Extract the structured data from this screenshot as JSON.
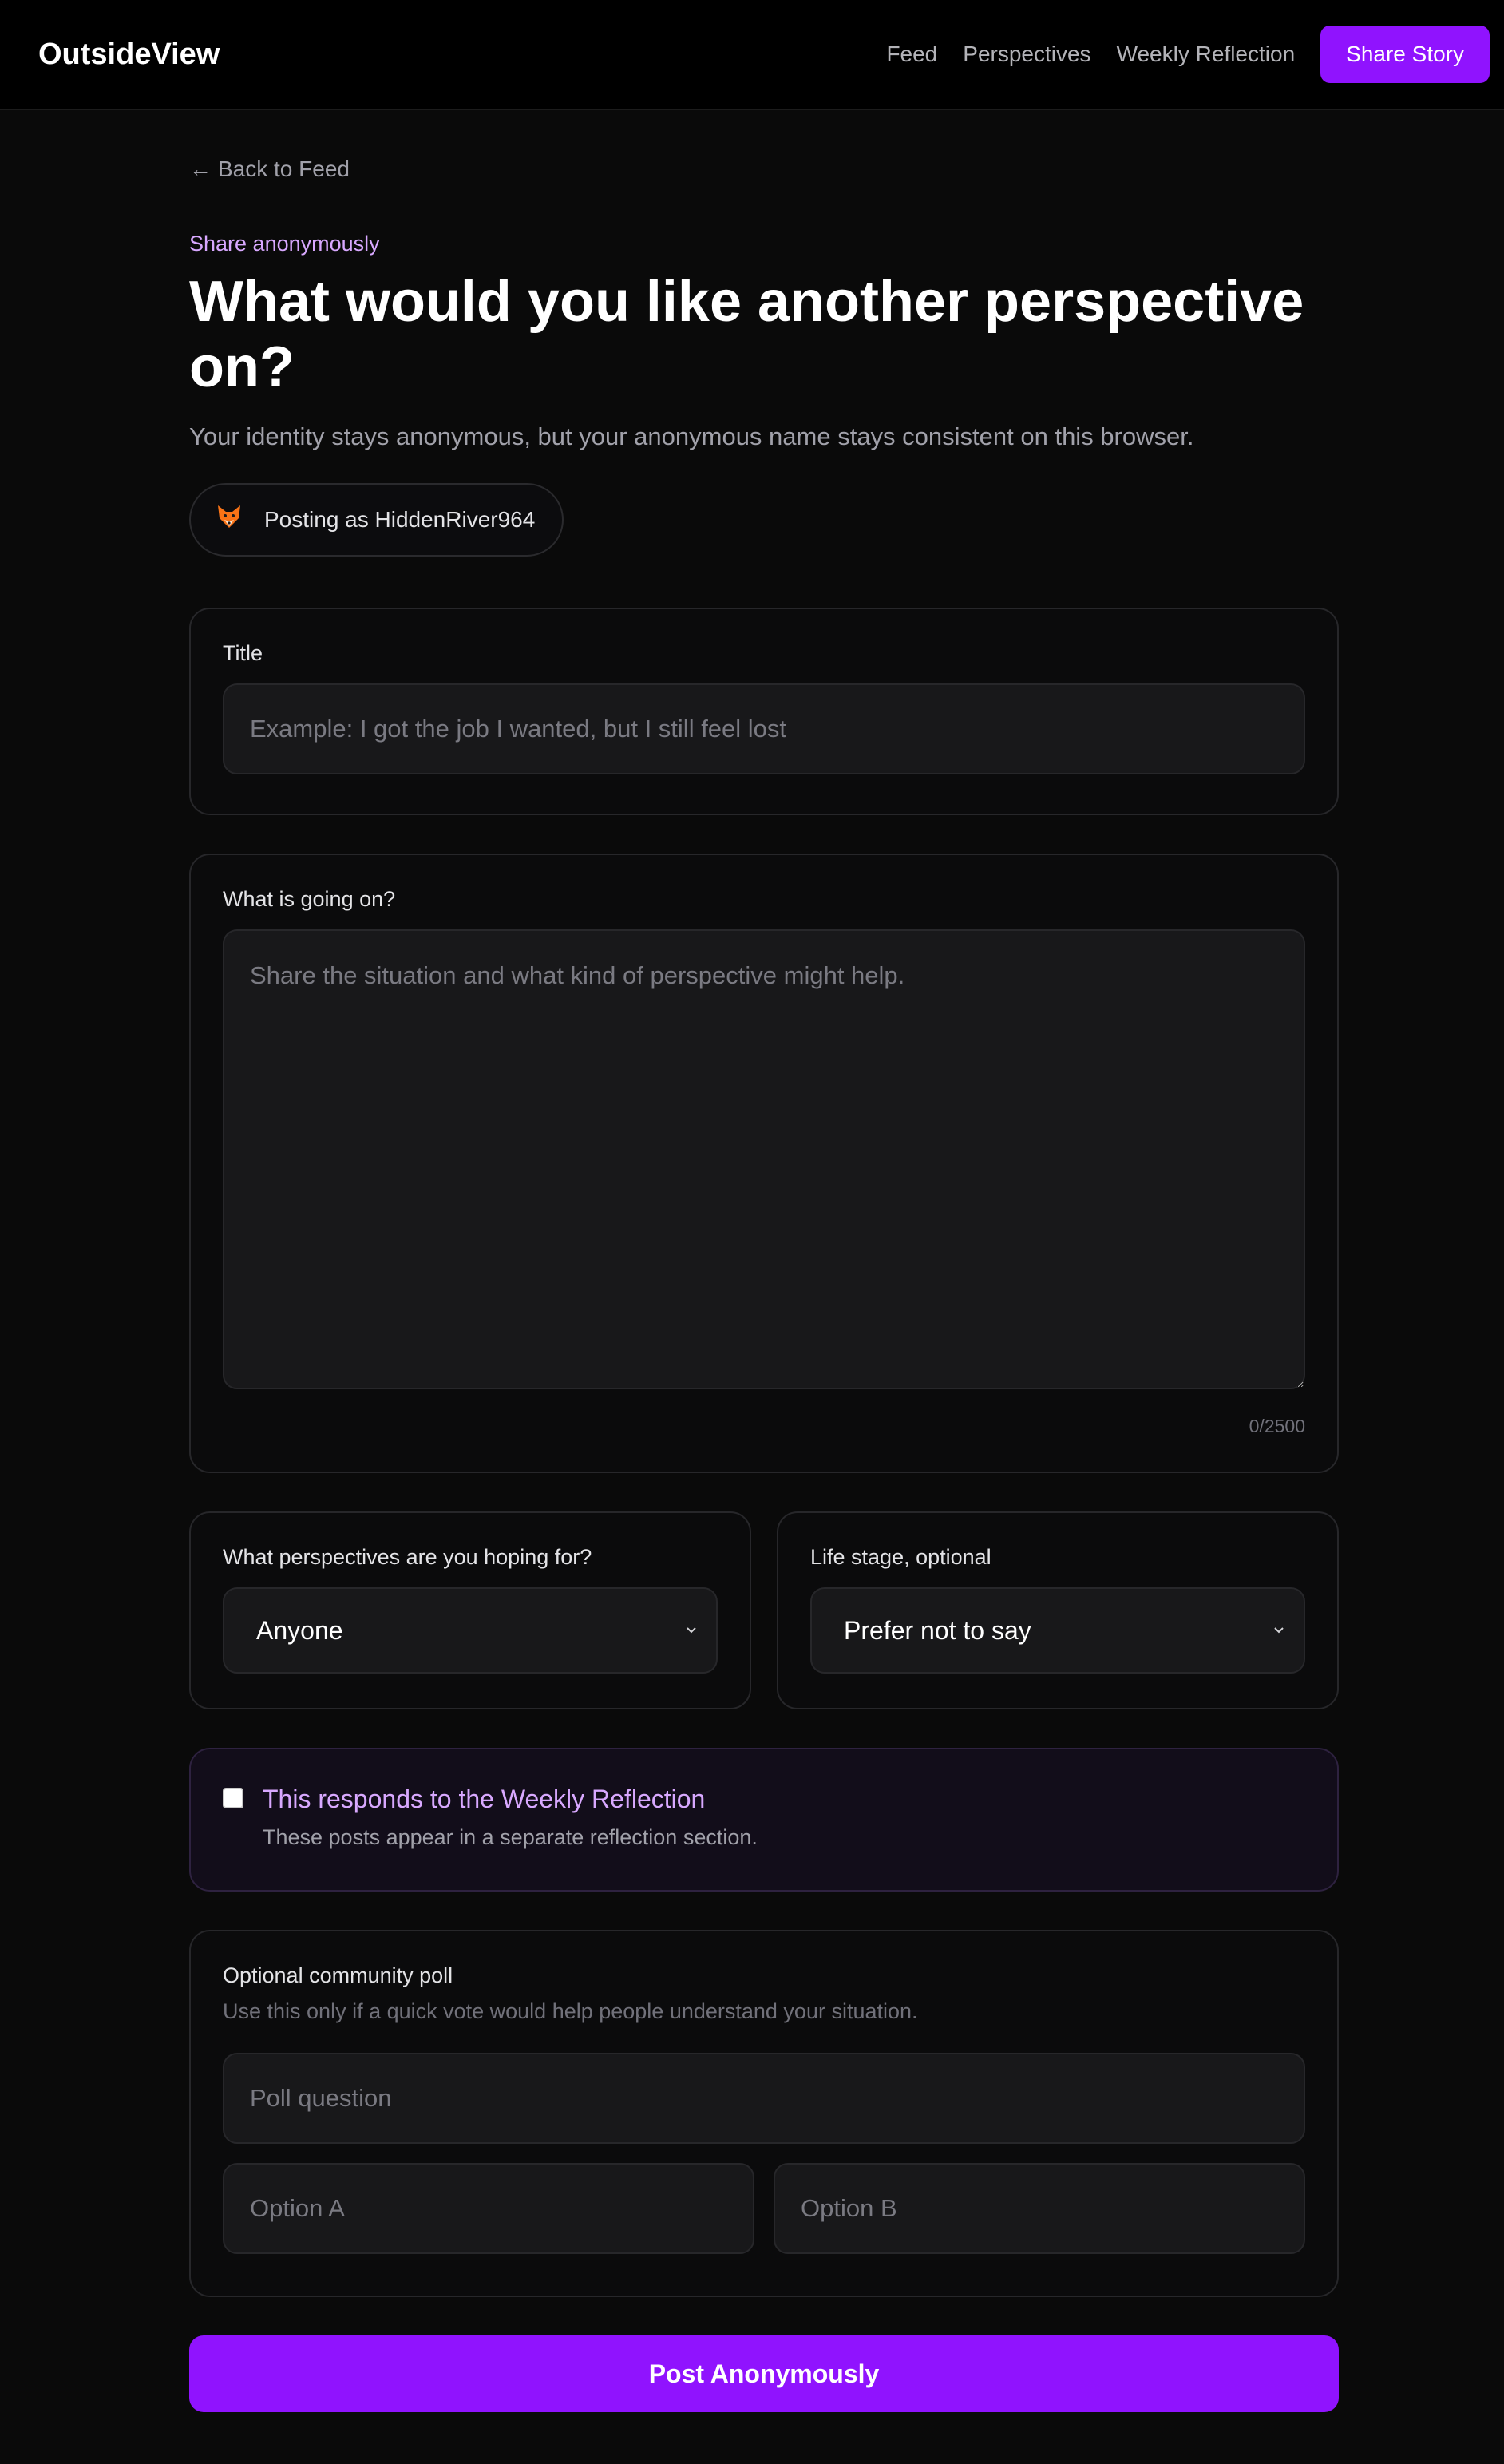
{
  "nav": {
    "brand": "OutsideView",
    "links": [
      "Feed",
      "Perspectives",
      "Weekly Reflection"
    ],
    "cta": "Share Story"
  },
  "page": {
    "back_link": "Back to Feed",
    "back_icon": "arrow-left-icon",
    "eyebrow": "Share anonymously",
    "title": "What would you like another perspective on?",
    "subtitle": "Your identity stays anonymous, but your anonymous name stays consistent on this browser.",
    "identity": {
      "icon": "fox-icon",
      "text": "Posting as HiddenRiver964"
    }
  },
  "form": {
    "title_field": {
      "label": "Title",
      "value": "",
      "placeholder": "Example: I got the job I wanted, but I still feel lost"
    },
    "body_field": {
      "label": "What is going on?",
      "value": "",
      "placeholder": "Share the situation and what kind of perspective might help.",
      "counter": "0/2500"
    },
    "perspectives": {
      "label": "What perspectives are you hoping for?",
      "selected": "Anyone"
    },
    "life_stage": {
      "label": "Life stage, optional",
      "selected": "Prefer not to say"
    },
    "reflection": {
      "checked": false,
      "title": "This responds to the Weekly Reflection",
      "description": "These posts appear in a separate reflection section."
    },
    "poll": {
      "label": "Optional community poll",
      "description": "Use this only if a quick vote would help people understand your situation.",
      "question_placeholder": "Poll question",
      "option_a_placeholder": "Option A",
      "option_b_placeholder": "Option B"
    },
    "submit": "Post Anonymously"
  },
  "colors": {
    "accent": "#9013fe",
    "accent_text": "#d8a8ff",
    "background": "#0a0a0a"
  }
}
